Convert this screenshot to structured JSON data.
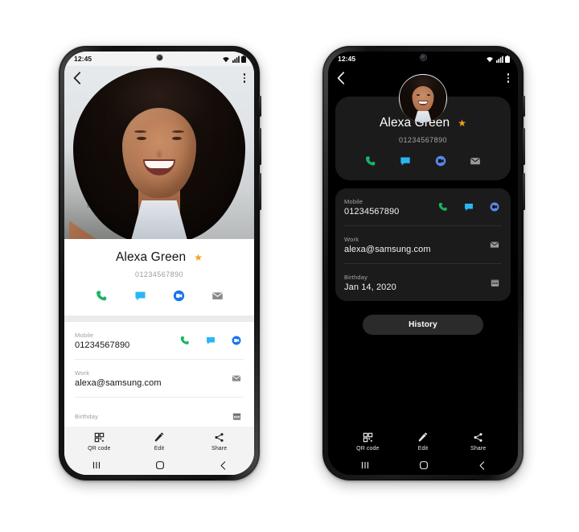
{
  "status_bar": {
    "time": "12:45",
    "icons": [
      "wifi-icon",
      "signal-icon",
      "battery-icon"
    ]
  },
  "app_bar": {
    "back": "back-arrow-icon",
    "more": "more-options-icon"
  },
  "contact": {
    "name": "Alexa Green",
    "number": "01234567890",
    "favorite": true,
    "star_glyph": "★",
    "quick_actions": [
      {
        "name": "call",
        "icon": "phone-icon",
        "color": "#1ab563"
      },
      {
        "name": "message",
        "icon": "message-icon",
        "color": "#29b6f6"
      },
      {
        "name": "video-call",
        "icon": "duo-video-icon",
        "color": "#1a73e8"
      },
      {
        "name": "email",
        "icon": "envelope-icon",
        "color": "#8a8a8a"
      }
    ]
  },
  "details": {
    "rows": [
      {
        "label": "Mobile",
        "value": "01234567890",
        "actions": [
          "phone-icon",
          "message-icon",
          "duo-video-icon"
        ]
      },
      {
        "label": "Work",
        "value": "alexa@samsung.com",
        "actions": [
          "envelope-icon"
        ]
      },
      {
        "label": "Birthday",
        "value": "Jan 14, 2020",
        "actions": [
          "calendar-icon"
        ]
      }
    ]
  },
  "birthday_partial": {
    "label": "Birthday"
  },
  "history_button": {
    "label": "History"
  },
  "bottom_tools": [
    {
      "label": "QR code",
      "icon": "qr-code-icon"
    },
    {
      "label": "Edit",
      "icon": "pencil-icon"
    },
    {
      "label": "Share",
      "icon": "share-icon"
    }
  ],
  "nav_bar": {
    "recents": "recents-icon",
    "home": "home-icon",
    "back": "back-nav-icon"
  },
  "colors": {
    "accent_star": "#f3a01c",
    "call_green": "#1ab563",
    "message_blue": "#29b6f6",
    "duo_blue": "#1a73e8",
    "envelope_gray": "#8a8a8a",
    "light_bg": "#ffffff",
    "light_chrome": "#f3f3f3",
    "dark_bg": "#000000",
    "dark_card": "#1b1b1b",
    "history_bg": "#2b2b2b"
  }
}
